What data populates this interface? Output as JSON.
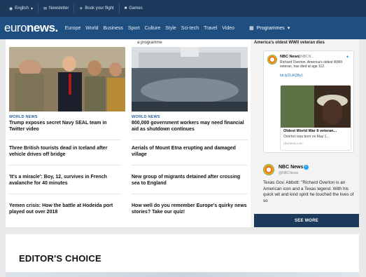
{
  "topbar": {
    "language": "English",
    "newsletter": "Newsletter",
    "book_flight": "Book your flight",
    "games": "Games"
  },
  "navbar": {
    "logo_a": "euro",
    "logo_b": "news.",
    "links": [
      "Europe",
      "World",
      "Business",
      "Sport",
      "Culture",
      "Style",
      "Sci-tech",
      "Travel",
      "Video"
    ],
    "programmes": "Programmes"
  },
  "main": {
    "top_fragment": "a programme",
    "featured": [
      {
        "category": "WORLD NEWS",
        "headline": "Trump exposes secret Navy SEAL team in Twitter video"
      },
      {
        "category": "WORLD NEWS",
        "headline": "800,000 government workers may need financial aid as shutdown continues"
      }
    ],
    "list_left": [
      "Three British tourists dead in Iceland after vehicle drives off bridge",
      "'It's a miracle': Boy, 12, survives in French avalanche for 40 minutes",
      "Yemen crisis: How the battle at Hodeida port played out over 2018"
    ],
    "list_right": [
      "Aerials of Mount Etna erupting and damaged village",
      "New group of migrants detained after crossing sea to England",
      "How well do you remember Europe's quirky news stories? Take our quiz!"
    ]
  },
  "sidebar": {
    "title": "America's oldest WWII veteran dies",
    "tweet": {
      "name": "NBC News",
      "handle": "@NBCN...",
      "text": "Richard Overton, America's oldest WWII veteran, has died at age 112.",
      "link": "bit.ly/2LAQBy1",
      "card_title": "Oldest World War II veteran...",
      "card_desc": "Overton was born on May 1...",
      "card_src": "nbcnews.com"
    },
    "nbc_name": "NBC News",
    "nbc_handle": "@NBCNews",
    "nbc_text": "Texas Gov. Abbott: \"Richard Overton is an American icon and a Texas legend. With his quick wit and kind spirit he touched the lives of so",
    "see_more": "SEE MORE"
  },
  "editors_choice": {
    "title": "EDITOR'S CHOICE"
  },
  "colors": {
    "topbar": "#1c3a5c",
    "navbar": "#1f4e80",
    "category": "#2c5e9a"
  }
}
